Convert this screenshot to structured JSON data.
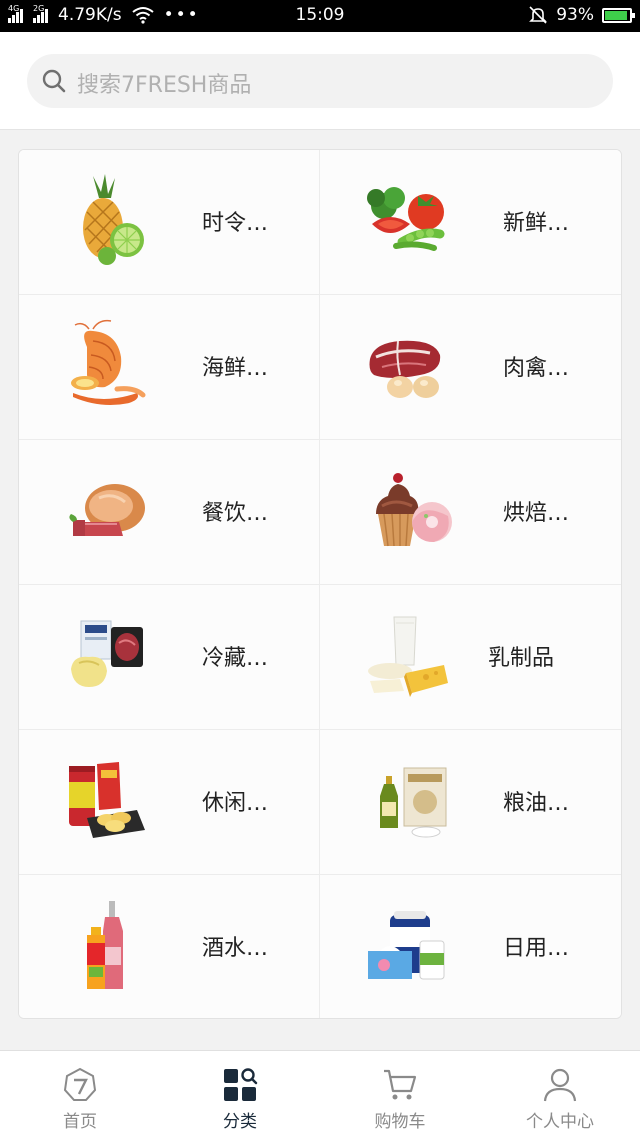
{
  "status_bar": {
    "signal1": "4G",
    "signal2": "2G",
    "net_speed": "4.79K/s",
    "more": "•••",
    "time": "15:09",
    "battery": "93%",
    "battery_level": 0.93
  },
  "search": {
    "placeholder": "搜索7FRESH商品"
  },
  "categories": [
    {
      "label": "时令…",
      "icon": "pineapple-lime-icon"
    },
    {
      "label": "新鲜…",
      "icon": "vegetables-icon"
    },
    {
      "label": "海鲜…",
      "icon": "shrimp-icon"
    },
    {
      "label": "肉禽…",
      "icon": "steak-eggs-icon"
    },
    {
      "label": "餐饮…",
      "icon": "ham-icon"
    },
    {
      "label": "烘焙…",
      "icon": "cupcake-icon"
    },
    {
      "label": "冷藏…",
      "icon": "chilled-food-icon"
    },
    {
      "label": "乳制品",
      "icon": "milk-cheese-icon"
    },
    {
      "label": "休闲…",
      "icon": "snacks-chips-icon"
    },
    {
      "label": "粮油…",
      "icon": "rice-oil-icon"
    },
    {
      "label": "酒水…",
      "icon": "drinks-bottles-icon"
    },
    {
      "label": "日用…",
      "icon": "household-goods-icon"
    }
  ],
  "tabbar": {
    "home": "首页",
    "category": "分类",
    "cart": "购物车",
    "profile": "个人中心"
  },
  "colors": {
    "active_tab": "#1a2a3a",
    "inactive_tab": "#8a8a8a",
    "battery_fill": "#3ecf4a"
  }
}
